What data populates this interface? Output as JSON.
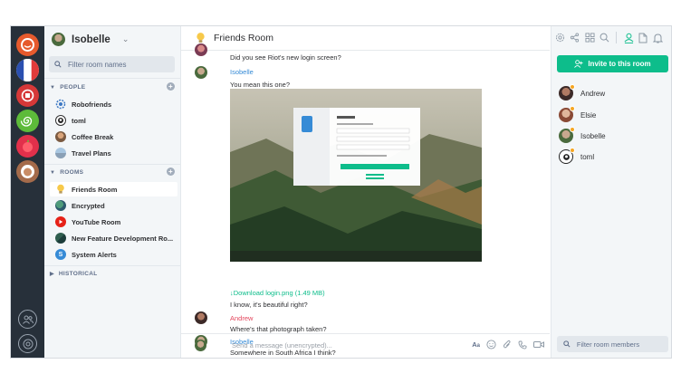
{
  "colors": {
    "accent": "#0dbd8b",
    "sidebar": "#27303a",
    "isobelle": "#368bd6",
    "andrew": "#e3475d"
  },
  "user": {
    "name": "Isobelle"
  },
  "search": {
    "placeholder": "Filter room names"
  },
  "people": {
    "header": "PEOPLE",
    "items": [
      {
        "label": "Robofriends",
        "icon": "robot-icon"
      },
      {
        "label": "toml",
        "icon": "avatar"
      },
      {
        "label": "Coffee Break",
        "icon": "avatar"
      },
      {
        "label": "Travel Plans",
        "icon": "avatar"
      }
    ]
  },
  "rooms": {
    "header": "ROOMS",
    "items": [
      {
        "label": "Friends Room",
        "icon": "lightbulb-icon"
      },
      {
        "label": "Encrypted",
        "icon": "avatar"
      },
      {
        "label": "YouTube Room",
        "icon": "youtube-icon"
      },
      {
        "label": "New Feature Development Ro...",
        "icon": "avatar"
      },
      {
        "label": "System Alerts",
        "icon": "letter-s"
      }
    ]
  },
  "historical": {
    "header": "HISTORICAL"
  },
  "room": {
    "title": "Friends Room"
  },
  "messages": [
    {
      "text": "Did you see Riot's new login screen?"
    },
    {
      "sender": "Isobelle",
      "text": "You mean this one?"
    },
    {
      "attachment": "↓Download login.png (1.49 MB)"
    },
    {
      "text": "I know, it's beautiful right?"
    },
    {
      "sender": "Andrew",
      "text": "Where's that photograph taken?"
    },
    {
      "sender": "Isobelle",
      "text": "Somewhere in South Africa I think?"
    }
  ],
  "composer": {
    "placeholder": "Send a message (unencrypted)..."
  },
  "right": {
    "invite_label": "Invite to this room",
    "members": [
      "Andrew",
      "Elsie",
      "Isobelle",
      "toml"
    ],
    "filter_placeholder": "Filter room members"
  }
}
